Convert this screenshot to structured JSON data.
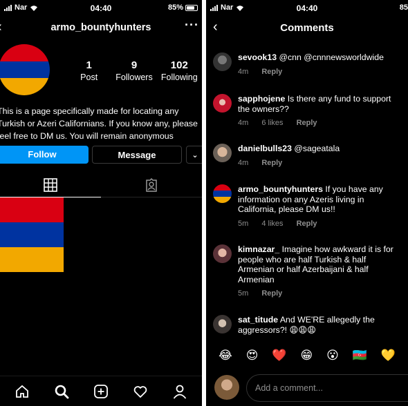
{
  "left": {
    "status": {
      "carrier": "Nar",
      "time": "04:40",
      "battery": "85%"
    },
    "header": {
      "username": "armo_bountyhunters",
      "more": "···"
    },
    "stats": [
      {
        "num": "1",
        "label": "Post"
      },
      {
        "num": "9",
        "label": "Followers"
      },
      {
        "num": "102",
        "label": "Following"
      }
    ],
    "bio": [
      "This is a page specifically made for locating any",
      "Turkish or Azeri Californians. If you know any, please",
      "feel free to DM us. You will remain anonymous"
    ],
    "buttons": {
      "follow": "Follow",
      "message": "Message",
      "dropdown": "⌄"
    },
    "flag_colors": {
      "red": "#d90012",
      "blue": "#0033a0",
      "orange": "#f2a800"
    }
  },
  "right": {
    "status": {
      "carrier": "Nar",
      "time": "04:40",
      "battery": "85"
    },
    "header": {
      "title": "Comments"
    },
    "comments": [
      {
        "user": "sevook13",
        "text": "@cnn @cnnnewsworldwide",
        "time": "4m",
        "likes": "",
        "reply": "Reply",
        "avatar": "gray-icon"
      },
      {
        "user": "sapphojene",
        "text": "Is there any fund to support the owners??",
        "time": "4m",
        "likes": "6 likes",
        "reply": "Reply",
        "avatar": "red-icon"
      },
      {
        "user": "danielbulls23",
        "text": "@sageatala",
        "time": "4m",
        "likes": "",
        "reply": "Reply",
        "avatar": "beige-icon"
      },
      {
        "user": "armo_bountyhunters",
        "text": "If you have any information on any Azeris living in California, please DM us!!",
        "time": "5m",
        "likes": "4 likes",
        "reply": "Reply",
        "avatar": "flag-icon"
      },
      {
        "user": "kimnazar_",
        "text": "Imagine how awkward it is for people who are half Turkish & half Armenian or half Azerbaijani & half Armenian",
        "time": "5m",
        "likes": "",
        "reply": "Reply",
        "avatar": "rose-icon"
      },
      {
        "user": "sat_titude",
        "text": "And WE'RE allegedly the aggressors?! 😩😩😩",
        "time": "",
        "likes": "",
        "reply": "",
        "avatar": "dark-icon"
      }
    ],
    "emojis": [
      "😂",
      "😍",
      "❤️",
      "😁",
      "😮",
      "🇦🇿",
      "💛"
    ],
    "compose_placeholder": "Add a comment..."
  }
}
